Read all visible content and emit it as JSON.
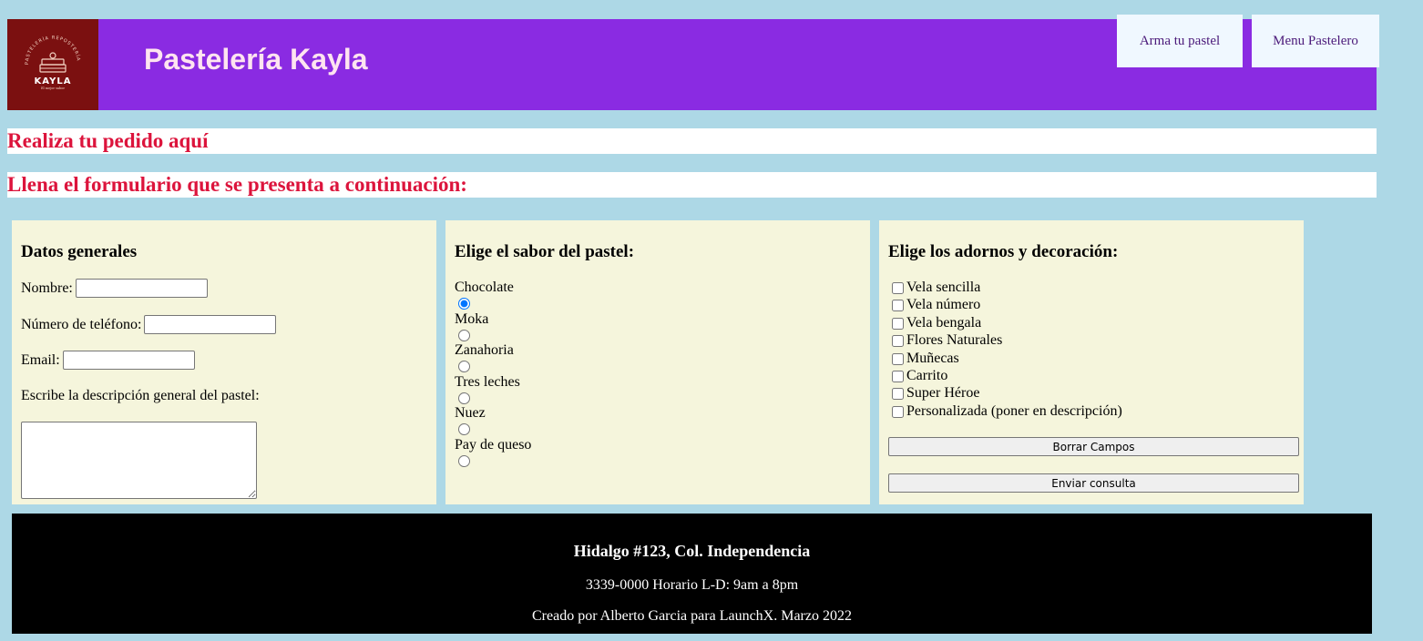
{
  "header": {
    "logo_text": "KAYLA",
    "logo_arc_text": "PASTELERÍA REPOSTERÍA",
    "logo_tagline": "El mejor sabor",
    "title": "Pastelería Kayla",
    "nav": [
      {
        "label": "Arma tu pastel"
      },
      {
        "label": "Menu Pastelero"
      }
    ]
  },
  "banners": {
    "order": "Realiza tu pedido aquí",
    "form": "Llena el formulario que se presenta a continuación:"
  },
  "general": {
    "heading": "Datos generales",
    "name_label": "Nombre:",
    "phone_label": "Número de teléfono:",
    "email_label": "Email:",
    "desc_label": "Escribe la descripción general del pastel:"
  },
  "flavors": {
    "heading": "Elige el sabor del pastel:",
    "options": [
      "Chocolate",
      "Moka",
      "Zanahoria",
      "Tres leches",
      "Nuez",
      "Pay de queso"
    ],
    "selected": "Chocolate"
  },
  "decorations": {
    "heading": "Elige los adornos y decoración:",
    "options": [
      "Vela sencilla",
      "Vela número",
      "Vela bengala",
      "Flores Naturales",
      "Muñecas",
      "Carrito",
      "Super Héroe",
      "Personalizada (poner en descripción)"
    ],
    "reset_label": "Borrar Campos",
    "submit_label": "Enviar consulta"
  },
  "footer": {
    "address": "Hidalgo #123, Col. Independencia",
    "hours": "3339-0000 Horario L-D: 9am a 8pm",
    "credit": "Creado por Alberto Garcia para LaunchX. Marzo 2022"
  },
  "colors": {
    "page_bg": "#add8e6",
    "header_bg": "#8a2be2",
    "logo_bg": "#7b1010",
    "banner_text": "#dc143c",
    "panel_bg": "#f5f5dc",
    "footer_bg": "#000000"
  }
}
